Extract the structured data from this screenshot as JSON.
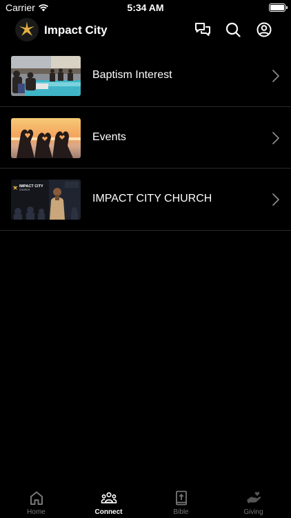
{
  "status": {
    "carrier": "Carrier",
    "time": "5:34 AM"
  },
  "header": {
    "title": "Impact City",
    "logo_icon": "sparkle-logo-icon",
    "actions": [
      "chat-icon",
      "search-icon",
      "account-icon"
    ],
    "accent_color": "#e3b13f"
  },
  "items": [
    {
      "label": "Baptism Interest",
      "thumb": "baptism-photo"
    },
    {
      "label": "Events",
      "thumb": "sunset-hearts-photo"
    },
    {
      "label": "IMPACT CITY CHURCH",
      "thumb": "church-speaker-photo",
      "thumb_overlay_title": "IMPACT CITY",
      "thumb_overlay_sub": "CHURCH"
    }
  ],
  "tabs": [
    {
      "label": "Home",
      "icon": "home-icon",
      "active": false
    },
    {
      "label": "Connect",
      "icon": "people-icon",
      "active": true
    },
    {
      "label": "Bible",
      "icon": "bible-icon",
      "active": false
    },
    {
      "label": "Giving",
      "icon": "giving-hand-icon",
      "active": false
    }
  ]
}
